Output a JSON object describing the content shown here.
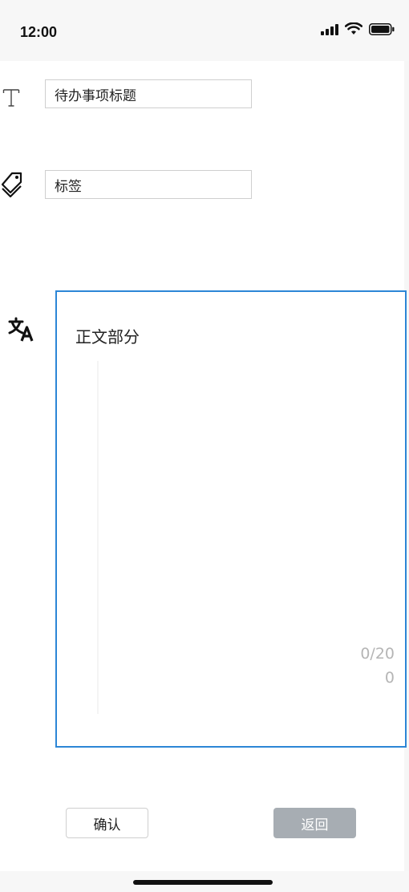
{
  "status_bar": {
    "time": "12:00"
  },
  "form": {
    "title_field": {
      "placeholder": "待办事项标题",
      "icon": "text-format-icon"
    },
    "tag_field": {
      "placeholder": "标签",
      "icon": "tag-icon"
    },
    "body_field": {
      "label": "正文部分",
      "icon": "translate-icon",
      "counter_line1": "0/20",
      "counter_line2": "0",
      "border_color": "#2c86d6"
    }
  },
  "buttons": {
    "confirm_label": "确认",
    "back_label": "返回",
    "back_color": "#a7adb3"
  }
}
